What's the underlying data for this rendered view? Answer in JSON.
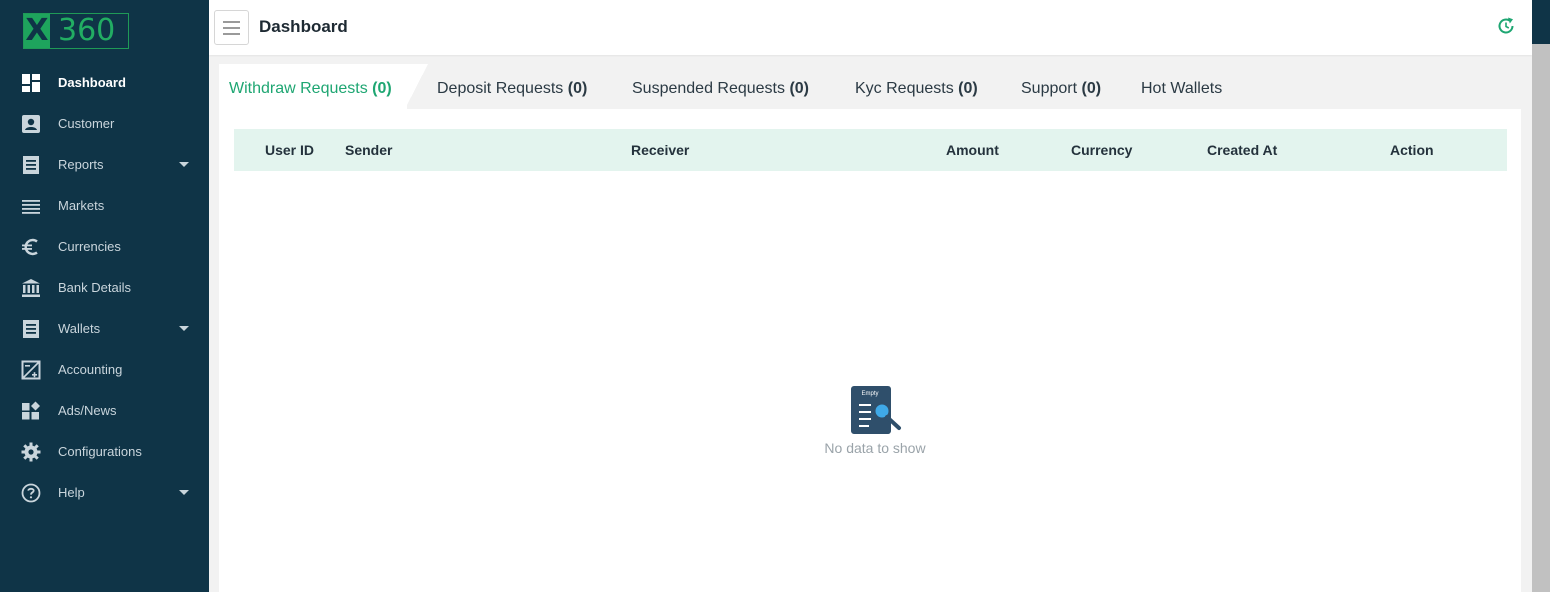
{
  "logo": {
    "x": "X",
    "number": "360"
  },
  "header": {
    "title": "Dashboard"
  },
  "sidebar": {
    "items": [
      {
        "label": "Dashboard",
        "icon": "dashboard-icon",
        "active": true
      },
      {
        "label": "Customer",
        "icon": "customer-icon"
      },
      {
        "label": "Reports",
        "icon": "reports-icon",
        "expandable": true
      },
      {
        "label": "Markets",
        "icon": "markets-icon"
      },
      {
        "label": "Currencies",
        "icon": "euro-icon"
      },
      {
        "label": "Bank Details",
        "icon": "bank-icon"
      },
      {
        "label": "Wallets",
        "icon": "wallets-icon",
        "expandable": true
      },
      {
        "label": "Accounting",
        "icon": "accounting-icon"
      },
      {
        "label": "Ads/News",
        "icon": "widgets-icon"
      },
      {
        "label": "Configurations",
        "icon": "gear-icon"
      },
      {
        "label": "Help",
        "icon": "help-icon",
        "expandable": true
      }
    ]
  },
  "tabs": [
    {
      "label": "Withdraw Requests",
      "count": "(0)",
      "active": true
    },
    {
      "label": "Deposit Requests",
      "count": "(0)"
    },
    {
      "label": "Suspended Requests",
      "count": "(0)"
    },
    {
      "label": "Kyc Requests",
      "count": "(0)"
    },
    {
      "label": "Support",
      "count": "(0)"
    },
    {
      "label": "Hot Wallets",
      "count": ""
    }
  ],
  "table": {
    "columns": [
      "User ID",
      "Sender",
      "Receiver",
      "Amount",
      "Currency",
      "Created At",
      "Action"
    ],
    "rows": [],
    "empty_badge": "Empty",
    "empty_text": "No data to show"
  },
  "colors": {
    "sidebar_bg": "#0f3447",
    "accent_green": "#1ea672",
    "table_header_bg": "#e3f4ee"
  }
}
